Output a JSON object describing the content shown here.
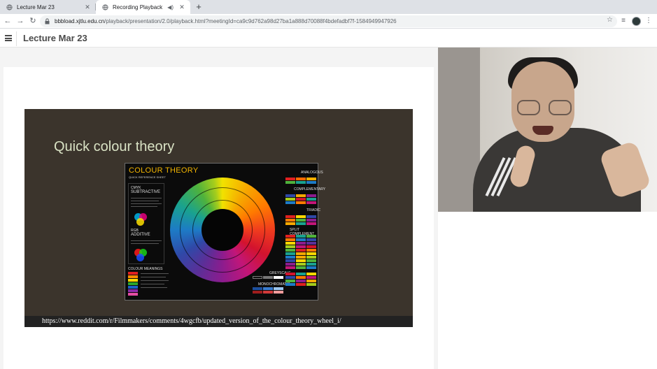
{
  "browser": {
    "tabs": [
      {
        "title": "Lecture Mar 23",
        "active": false
      },
      {
        "title": "Recording Playback",
        "active": true
      }
    ],
    "url_host": "bbbload.xjtlu.edu.cn",
    "url_path": "/playback/presentation/2.0/playback.html?meetingId=ca9c9d762a98d27ba1a888d70088f4bdefadbf7f-1584949947926"
  },
  "app": {
    "title": "Lecture Mar 23"
  },
  "slide": {
    "heading": "Quick colour theory",
    "source_url": "https://www.reddit.com/r/Filmmakers/comments/4wgcfb/updated_version_of_the_colour_theory_wheel_i/",
    "card_title": "COLOUR THEORY",
    "card_subtitle": "QUICK REFERENCE SHEET",
    "labels": {
      "cmyk": "CMYK",
      "subtractive": "SUBTRACTIVE",
      "rgb": "RGB",
      "additive": "ADDITIVE",
      "meanings": "COLOUR MEANINGS",
      "analogous": "ANALOGOUS",
      "complementary": "COMPLEMENTARY",
      "triadic": "TRIADIC",
      "split": "SPLIT COMPLEMENT",
      "greyscale": "GREYSCALE",
      "monochromatic": "MONOCHROMATIC"
    }
  },
  "colors": {
    "slide_bg": "#3b342c",
    "heading": "#d9e2c4",
    "card_title": "#f2b400"
  }
}
